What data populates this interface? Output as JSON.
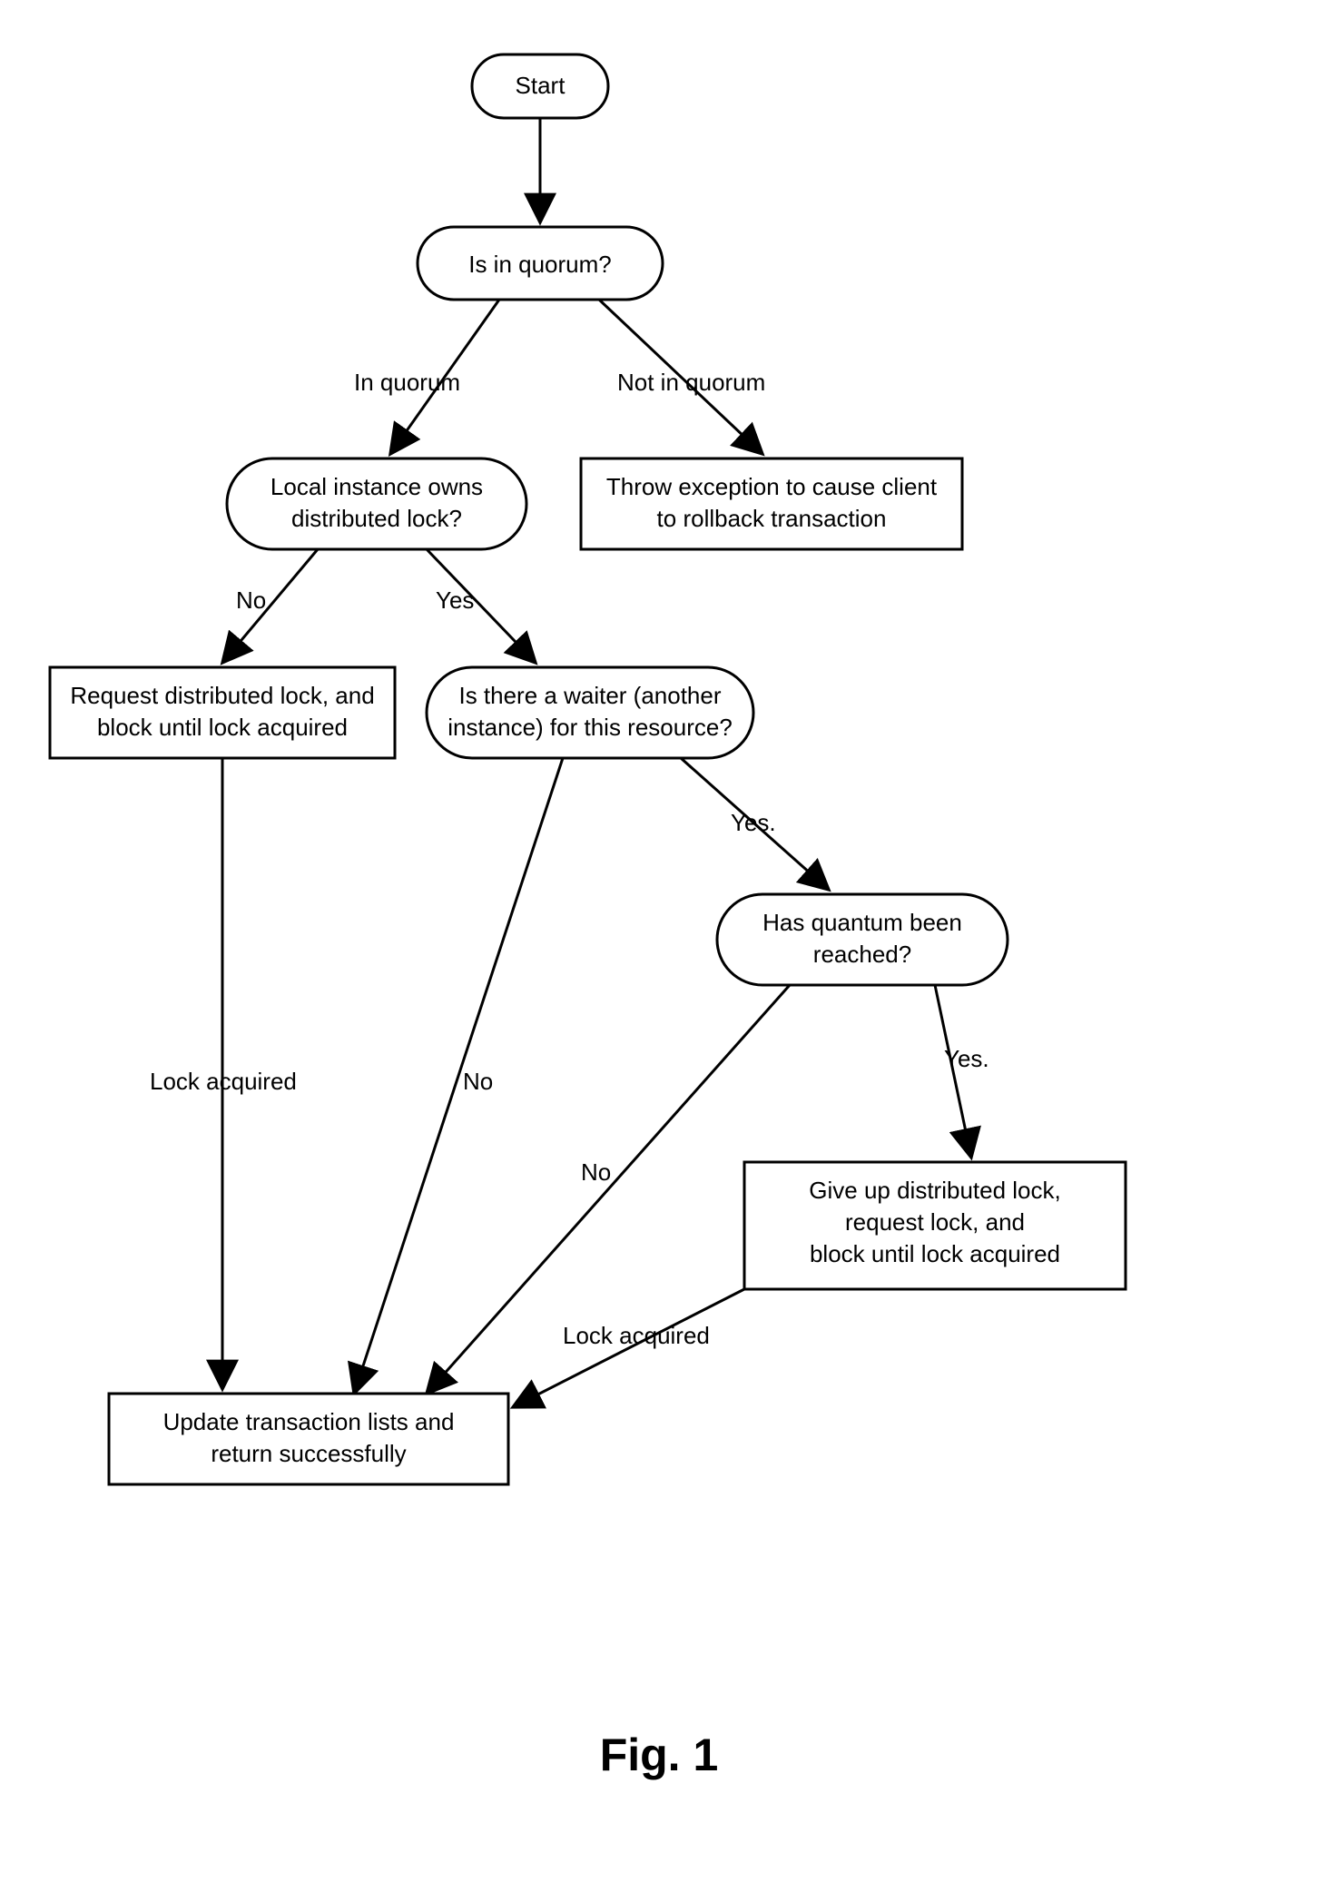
{
  "caption": "Fig. 1",
  "nodes": {
    "start": {
      "type": "terminator",
      "label": "Start"
    },
    "quorum": {
      "type": "decision",
      "label": "Is in quorum?"
    },
    "localOwns": {
      "type": "decision",
      "line1": "Local instance owns",
      "line2": "distributed lock?"
    },
    "throw": {
      "type": "process",
      "line1": "Throw exception to cause client",
      "line2": "to rollback transaction"
    },
    "request": {
      "type": "process",
      "line1": "Request distributed lock, and",
      "line2": "block until lock acquired"
    },
    "waiter": {
      "type": "decision",
      "line1": "Is there a waiter (another",
      "line2": "instance) for this resource?"
    },
    "quantum": {
      "type": "decision",
      "line1": "Has quantum been",
      "line2": "reached?"
    },
    "giveup": {
      "type": "process",
      "line1": "Give up distributed lock,",
      "line2": "request lock, and",
      "line3": "block until lock acquired"
    },
    "update": {
      "type": "process",
      "line1": "Update transaction lists and",
      "line2": "return successfully"
    }
  },
  "edges": {
    "start_quorum": "",
    "quorum_local": "In quorum",
    "quorum_throw": "Not in quorum",
    "local_no": "No",
    "local_yes": "Yes",
    "request_update": "Lock acquired",
    "waiter_yes": "Yes.",
    "waiter_no": "No",
    "quantum_yes": "Yes.",
    "quantum_no": "No",
    "giveup_update": "Lock acquired"
  }
}
